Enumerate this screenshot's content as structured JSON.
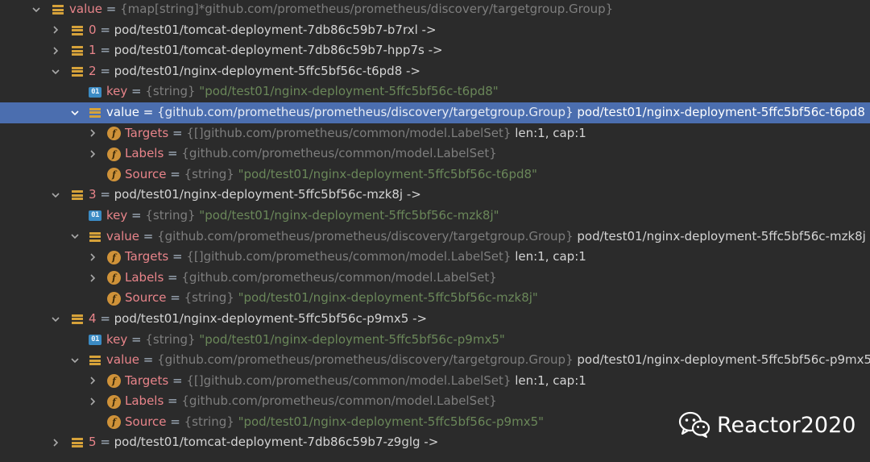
{
  "tree": [
    {
      "depth": 0,
      "expanded": true,
      "icon": "list-icon",
      "name": "value",
      "eq": " = ",
      "type": "{map[string]*github.com/prometheus/prometheus/discovery/targetgroup.Group}",
      "value": ""
    },
    {
      "depth": 1,
      "expanded": false,
      "icon": "list-icon",
      "name": "0",
      "eq": " = ",
      "type": "",
      "value": "pod/test01/tomcat-deployment-7db86c59b7-b7rxl ->"
    },
    {
      "depth": 1,
      "expanded": false,
      "icon": "list-icon",
      "name": "1",
      "eq": " = ",
      "type": "",
      "value": "pod/test01/tomcat-deployment-7db86c59b7-hpp7s ->"
    },
    {
      "depth": 1,
      "expanded": true,
      "icon": "list-icon",
      "name": "2",
      "eq": " = ",
      "type": "",
      "value": "pod/test01/nginx-deployment-5ffc5bf56c-t6pd8 ->"
    },
    {
      "depth": 2,
      "expanded": null,
      "icon": "primitive-icon",
      "name": "key",
      "eq": " = ",
      "type": "{string} ",
      "str": "\"pod/test01/nginx-deployment-5ffc5bf56c-t6pd8\"",
      "value": ""
    },
    {
      "depth": 2,
      "expanded": true,
      "selected": true,
      "icon": "list-icon",
      "name": "value",
      "eq": " = ",
      "type": "{github.com/prometheus/prometheus/discovery/targetgroup.Group} ",
      "value": "pod/test01/nginx-deployment-5ffc5bf56c-t6pd8"
    },
    {
      "depth": 3,
      "expanded": false,
      "icon": "field-icon",
      "name": "Targets",
      "eq": " = ",
      "type": "{[]github.com/prometheus/common/model.LabelSet} ",
      "value": "len:1, cap:1"
    },
    {
      "depth": 3,
      "expanded": false,
      "icon": "field-icon",
      "name": "Labels",
      "eq": " = ",
      "type": "{github.com/prometheus/common/model.LabelSet}",
      "value": ""
    },
    {
      "depth": 3,
      "expanded": null,
      "icon": "field-icon",
      "name": "Source",
      "eq": " = ",
      "type": "{string} ",
      "str": "\"pod/test01/nginx-deployment-5ffc5bf56c-t6pd8\"",
      "value": ""
    },
    {
      "depth": 1,
      "expanded": true,
      "icon": "list-icon",
      "name": "3",
      "eq": " = ",
      "type": "",
      "value": "pod/test01/nginx-deployment-5ffc5bf56c-mzk8j ->"
    },
    {
      "depth": 2,
      "expanded": null,
      "icon": "primitive-icon",
      "name": "key",
      "eq": " = ",
      "type": "{string} ",
      "str": "\"pod/test01/nginx-deployment-5ffc5bf56c-mzk8j\"",
      "value": ""
    },
    {
      "depth": 2,
      "expanded": true,
      "icon": "list-icon",
      "name": "value",
      "eq": " = ",
      "type": "{github.com/prometheus/prometheus/discovery/targetgroup.Group} ",
      "value": "pod/test01/nginx-deployment-5ffc5bf56c-mzk8j"
    },
    {
      "depth": 3,
      "expanded": false,
      "icon": "field-icon",
      "name": "Targets",
      "eq": " = ",
      "type": "{[]github.com/prometheus/common/model.LabelSet} ",
      "value": "len:1, cap:1"
    },
    {
      "depth": 3,
      "expanded": false,
      "icon": "field-icon",
      "name": "Labels",
      "eq": " = ",
      "type": "{github.com/prometheus/common/model.LabelSet}",
      "value": ""
    },
    {
      "depth": 3,
      "expanded": null,
      "icon": "field-icon",
      "name": "Source",
      "eq": " = ",
      "type": "{string} ",
      "str": "\"pod/test01/nginx-deployment-5ffc5bf56c-mzk8j\"",
      "value": ""
    },
    {
      "depth": 1,
      "expanded": true,
      "icon": "list-icon",
      "name": "4",
      "eq": " = ",
      "type": "",
      "value": "pod/test01/nginx-deployment-5ffc5bf56c-p9mx5 ->"
    },
    {
      "depth": 2,
      "expanded": null,
      "icon": "primitive-icon",
      "name": "key",
      "eq": " = ",
      "type": "{string} ",
      "str": "\"pod/test01/nginx-deployment-5ffc5bf56c-p9mx5\"",
      "value": ""
    },
    {
      "depth": 2,
      "expanded": true,
      "icon": "list-icon",
      "name": "value",
      "eq": " = ",
      "type": "{github.com/prometheus/prometheus/discovery/targetgroup.Group} ",
      "value": "pod/test01/nginx-deployment-5ffc5bf56c-p9mx5"
    },
    {
      "depth": 3,
      "expanded": false,
      "icon": "field-icon",
      "name": "Targets",
      "eq": " = ",
      "type": "{[]github.com/prometheus/common/model.LabelSet} ",
      "value": "len:1, cap:1"
    },
    {
      "depth": 3,
      "expanded": false,
      "icon": "field-icon",
      "name": "Labels",
      "eq": " = ",
      "type": "{github.com/prometheus/common/model.LabelSet}",
      "value": ""
    },
    {
      "depth": 3,
      "expanded": null,
      "icon": "field-icon",
      "name": "Source",
      "eq": " = ",
      "type": "{string} ",
      "str": "\"pod/test01/nginx-deployment-5ffc5bf56c-p9mx5\"",
      "value": ""
    },
    {
      "depth": 1,
      "expanded": false,
      "icon": "list-icon",
      "name": "5",
      "eq": " = ",
      "type": "",
      "value": "pod/test01/tomcat-deployment-7db86c59b7-z9glg ->"
    }
  ],
  "primitive_icon_text": "01",
  "field_icon_text": "f",
  "watermark": {
    "text": "Reactor2020",
    "icon": "wechat-icon"
  },
  "colors": {
    "background": "#2b2b2b",
    "selection": "#4b6eaf",
    "name": "#e8848a",
    "type": "#7e7e7e",
    "string": "#6a8759",
    "list_icon": "#d6a23a",
    "field_icon": "#cf9239",
    "primitive_icon": "#3b8bc4"
  }
}
